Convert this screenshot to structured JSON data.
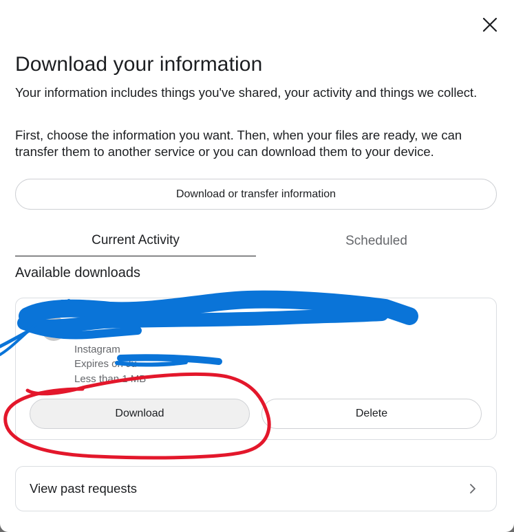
{
  "dialog": {
    "title": "Download your information",
    "description_1": "Your information includes things you've shared, your activity and things we collect.",
    "description_2": "First, choose the information you want. Then, when your files are ready, we can transfer them to another service or you can download them to your device.",
    "close_icon": "close-icon"
  },
  "actions": {
    "transfer_label": "Download or transfer information"
  },
  "tabs": [
    {
      "label": "Current Activity",
      "active": true
    },
    {
      "label": "Scheduled",
      "active": false
    }
  ],
  "downloads": {
    "heading": "Available downloads",
    "items": [
      {
        "platform": "Instagram",
        "expires": "Expires on Ju",
        "size": "Less than 1 MB",
        "download_label": "Download",
        "delete_label": "Delete"
      }
    ]
  },
  "past_requests": {
    "label": "View past requests",
    "icon": "chevron-right-icon"
  },
  "colors": {
    "text": "#1c1e21",
    "secondary_text": "#65676b",
    "border": "#ced0d4",
    "scribble_blue": "#0a74d8",
    "annotation_red": "#e3172b"
  }
}
